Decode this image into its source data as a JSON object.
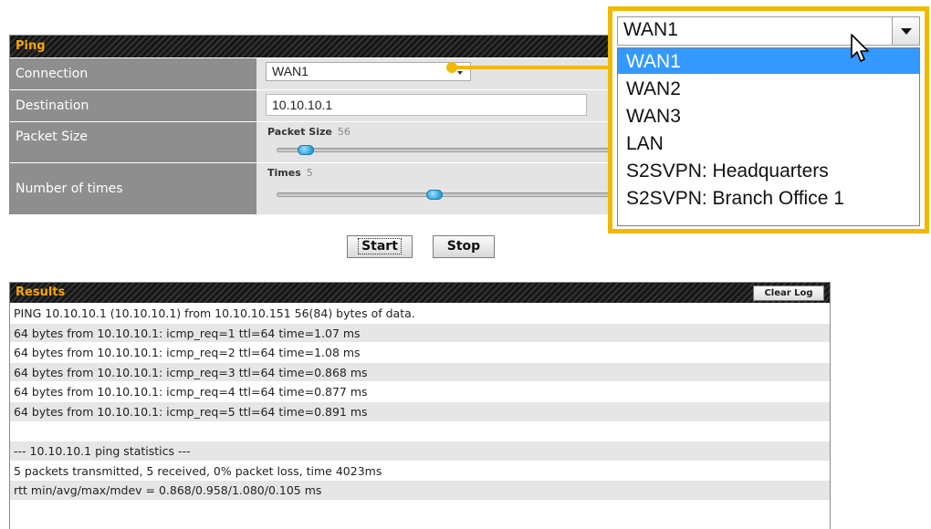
{
  "ping": {
    "title": "Ping",
    "connection_label": "Connection",
    "connection_value": "WAN1",
    "destination_label": "Destination",
    "destination_value": "10.10.10.1",
    "packet_size_label": "Packet Size",
    "packet_size_slider_label": "Packet Size",
    "packet_size_value": "56",
    "packet_size_level": 0.06,
    "times_label": "Number of times",
    "times_slider_label": "Times",
    "times_value": "5",
    "times_level": 0.45
  },
  "actions": {
    "start_label": "Start",
    "stop_label": "Stop"
  },
  "results": {
    "title": "Results",
    "clear_log_label": "Clear Log",
    "lines": [
      "PING 10.10.10.1 (10.10.10.1) from 10.10.10.151 56(84) bytes of data.",
      "64 bytes from 10.10.10.1: icmp_req=1 ttl=64 time=1.07 ms",
      "64 bytes from 10.10.10.1: icmp_req=2 ttl=64 time=1.08 ms",
      "64 bytes from 10.10.10.1: icmp_req=3 ttl=64 time=0.868 ms",
      "64 bytes from 10.10.10.1: icmp_req=4 ttl=64 time=0.877 ms",
      "64 bytes from 10.10.10.1: icmp_req=5 ttl=64 time=0.891 ms",
      "",
      "--- 10.10.10.1 ping statistics ---",
      "5 packets transmitted, 5 received, 0% packet loss, time 4023ms",
      "rtt min/avg/max/mdev = 0.868/0.958/1.080/0.105 ms"
    ]
  },
  "connection_dropdown": {
    "selected": "WAN1",
    "options": [
      "WAN1",
      "WAN2",
      "WAN3",
      "LAN",
      "S2SVPN: Headquarters",
      "S2SVPN: Branch Office 1"
    ],
    "highlighted_index": 0
  },
  "colors": {
    "header_text": "#f5a500",
    "callout": "#f3b800",
    "label_bg": "#8e8e8e",
    "highlight": "#3399ff"
  },
  "icons": {
    "cursor": "mouse-pointer-icon",
    "dropdown": "chevron-down-icon"
  }
}
